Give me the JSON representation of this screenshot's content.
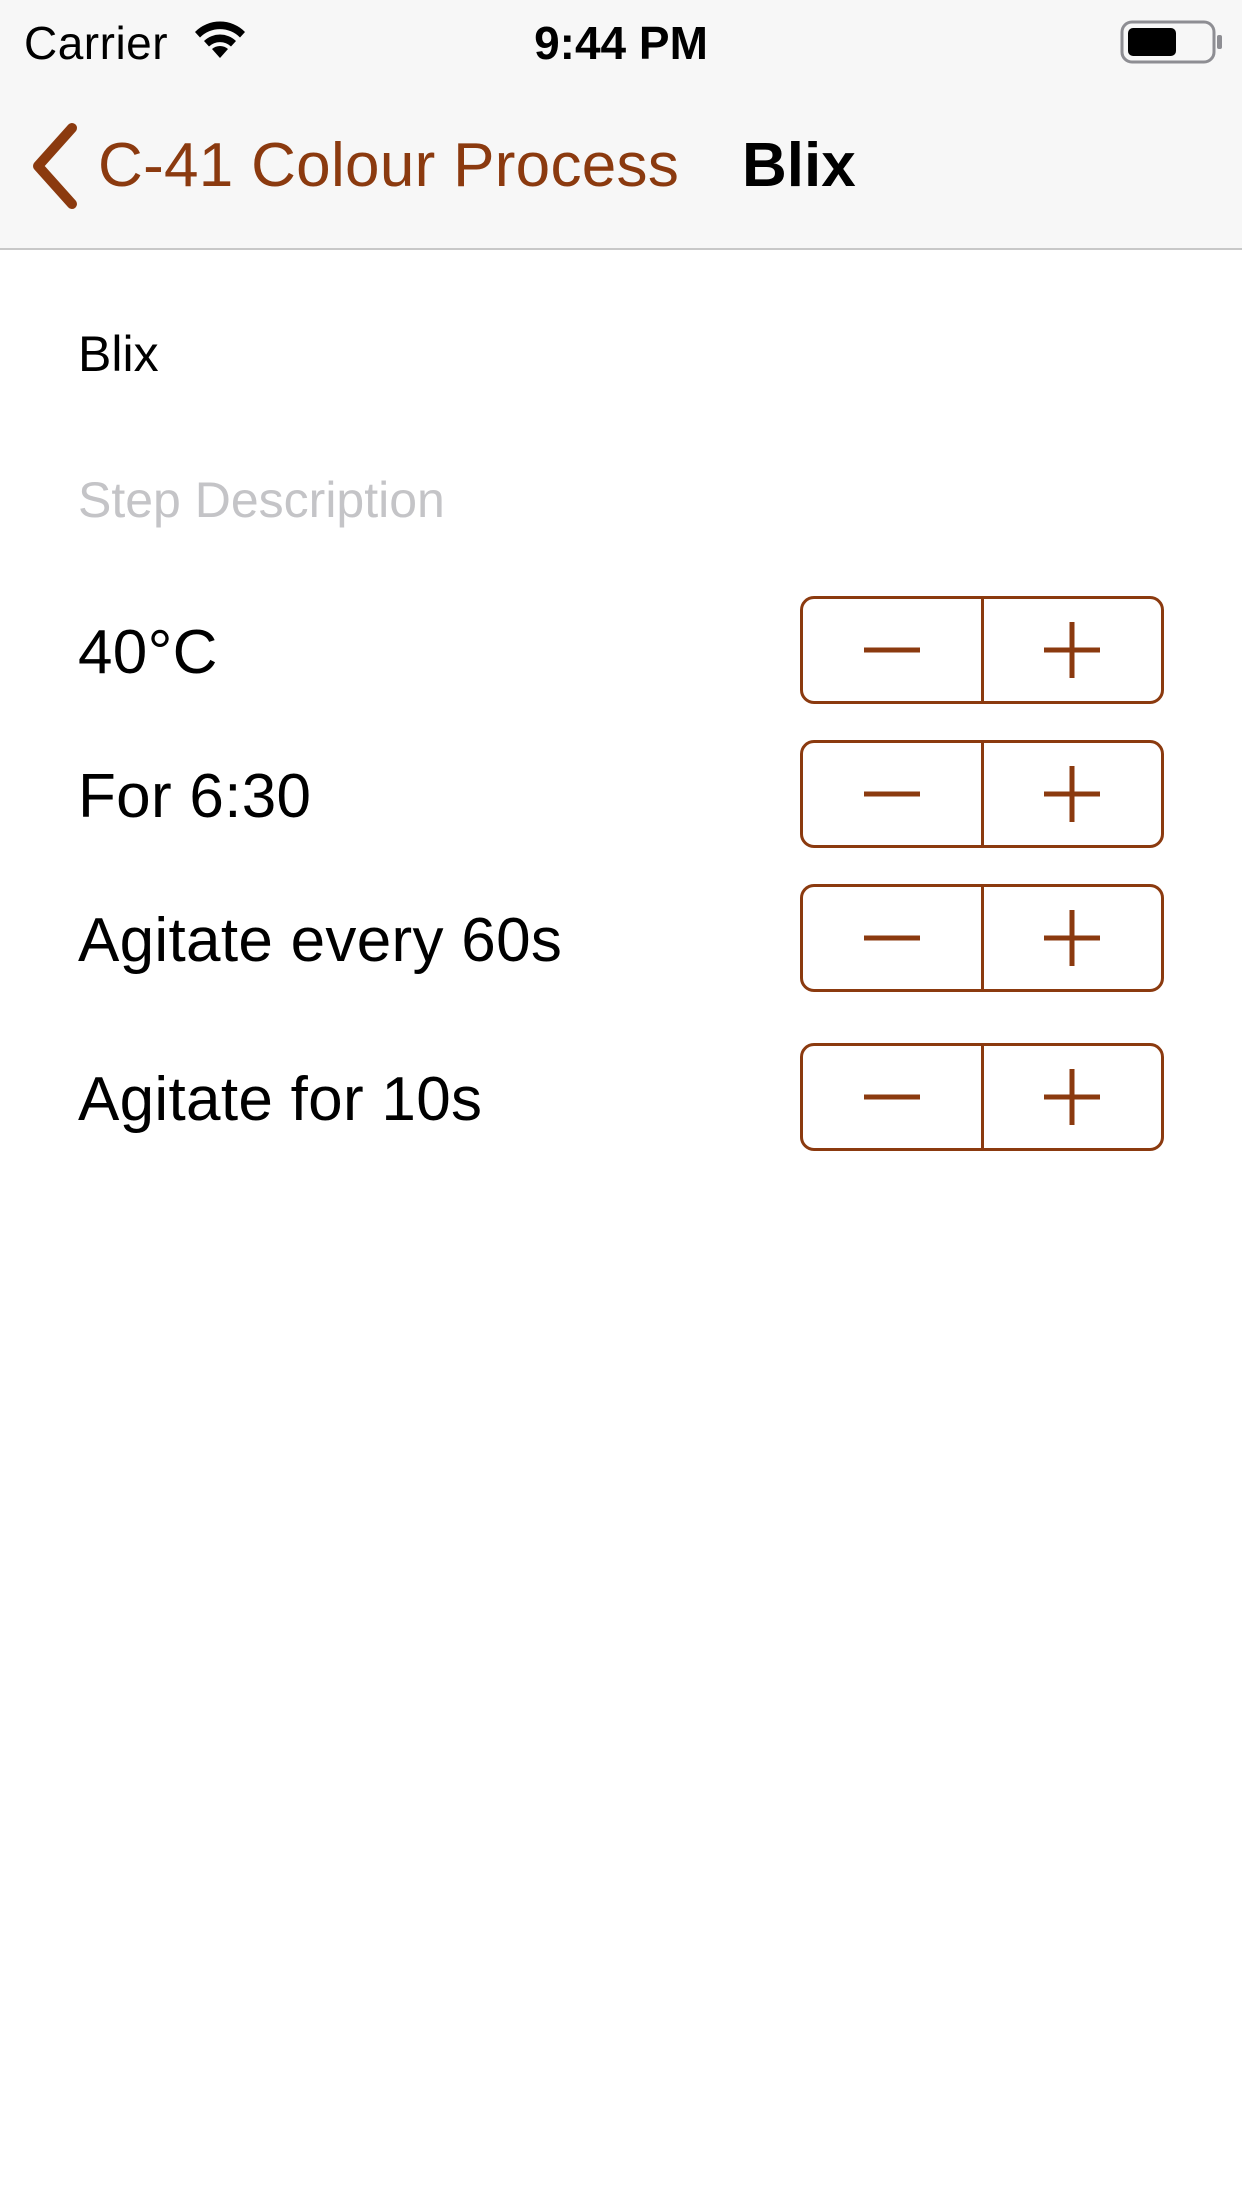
{
  "status_bar": {
    "carrier": "Carrier",
    "time": "9:44 PM",
    "battery_level": 0.6
  },
  "nav": {
    "back_label": "C-41 Colour Process",
    "title": "Blix"
  },
  "step": {
    "name": "Blix",
    "description_value": "",
    "description_placeholder": "Step Description"
  },
  "settings": [
    {
      "label": "40°C",
      "decrement_icon": "minus-icon",
      "increment_icon": "plus-icon"
    },
    {
      "label": "For 6:30",
      "decrement_icon": "minus-icon",
      "increment_icon": "plus-icon"
    },
    {
      "label": "Agitate every 60s",
      "decrement_icon": "minus-icon",
      "increment_icon": "plus-icon"
    },
    {
      "label": "Agitate for 10s",
      "decrement_icon": "minus-icon",
      "increment_icon": "plus-icon"
    }
  ],
  "colors": {
    "accent": "#8b3a0f",
    "placeholder": "#c4c4c7",
    "bar_background": "#f7f7f7"
  }
}
